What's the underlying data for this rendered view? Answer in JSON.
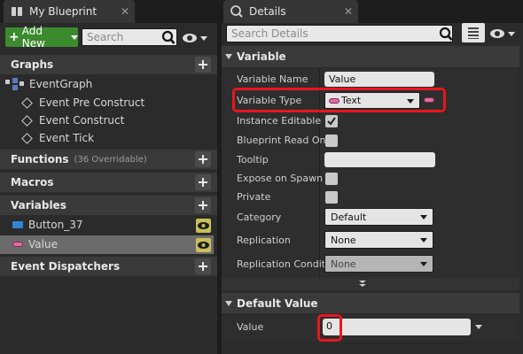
{
  "left_panel": {
    "tab_title": "My Blueprint",
    "add_new_label": "Add New",
    "search_placeholder": "Search",
    "sections": {
      "graphs": "Graphs",
      "functions": "Functions",
      "functions_note": "(36 Overridable)",
      "macros": "Macros",
      "variables": "Variables",
      "event_dispatchers": "Event Dispatchers"
    },
    "event_graph": "EventGraph",
    "events": [
      "Event Pre Construct",
      "Event Construct",
      "Event Tick"
    ],
    "variables": [
      "Button_37",
      "Value"
    ]
  },
  "right_panel": {
    "tab_title": "Details",
    "search_placeholder": "Search Details",
    "variable_section": "Variable",
    "rows": {
      "variable_name": "Variable Name",
      "variable_type": "Variable Type",
      "instance_editable": "Instance Editable",
      "blueprint_read_only": "Blueprint Read Onl",
      "tooltip": "Tooltip",
      "expose_on_spawn": "Expose on Spawn",
      "private": "Private",
      "category": "Category",
      "replication": "Replication",
      "replication_condition": "Replication Conditi"
    },
    "values": {
      "variable_name": "Value",
      "variable_type": "Text",
      "category": "Default",
      "replication": "None",
      "replication_condition": "None"
    },
    "default_value_section": "Default Value",
    "default_value_label": "Value",
    "default_value": "0"
  },
  "colors": {
    "accent_green": "#3c8a2e",
    "text_pin_pink": "#e06ca0",
    "object_pin_blue": "#2f86d8",
    "highlight_red": "#e8161e",
    "selected_row": "#6b6b6b"
  }
}
